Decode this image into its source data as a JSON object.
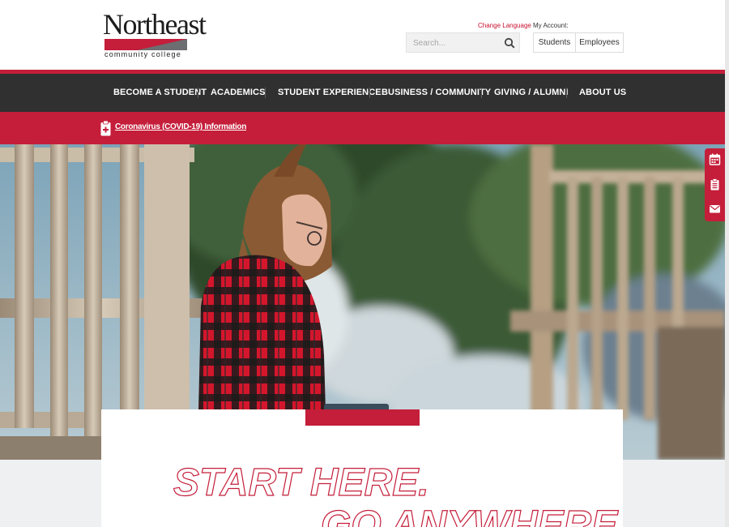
{
  "header": {
    "logo": {
      "word": "Northeast",
      "subtitle": "community college"
    },
    "change_language": "Change Language",
    "my_account_label": "My Account:",
    "search_placeholder": "Search...",
    "account_buttons": [
      "Students",
      "Employees"
    ]
  },
  "nav": {
    "items": [
      "BECOME A STUDENT",
      "ACADEMICS",
      "STUDENT EXPERIENCE",
      "BUSINESS / COMMUNITY",
      "GIVING / ALUMNI",
      "ABOUT US"
    ]
  },
  "alert": {
    "link": "Coronavirus (COVID-19) Information"
  },
  "side_tools": {
    "icons": [
      "calendar-icon",
      "clipboard-icon",
      "envelope-icon"
    ]
  },
  "hero": {
    "tagline_line1": "START HERE.",
    "tagline_line2": "GO ANYWHERE"
  },
  "colors": {
    "brand_red": "#c41e3a",
    "nav_bg": "#303030"
  }
}
